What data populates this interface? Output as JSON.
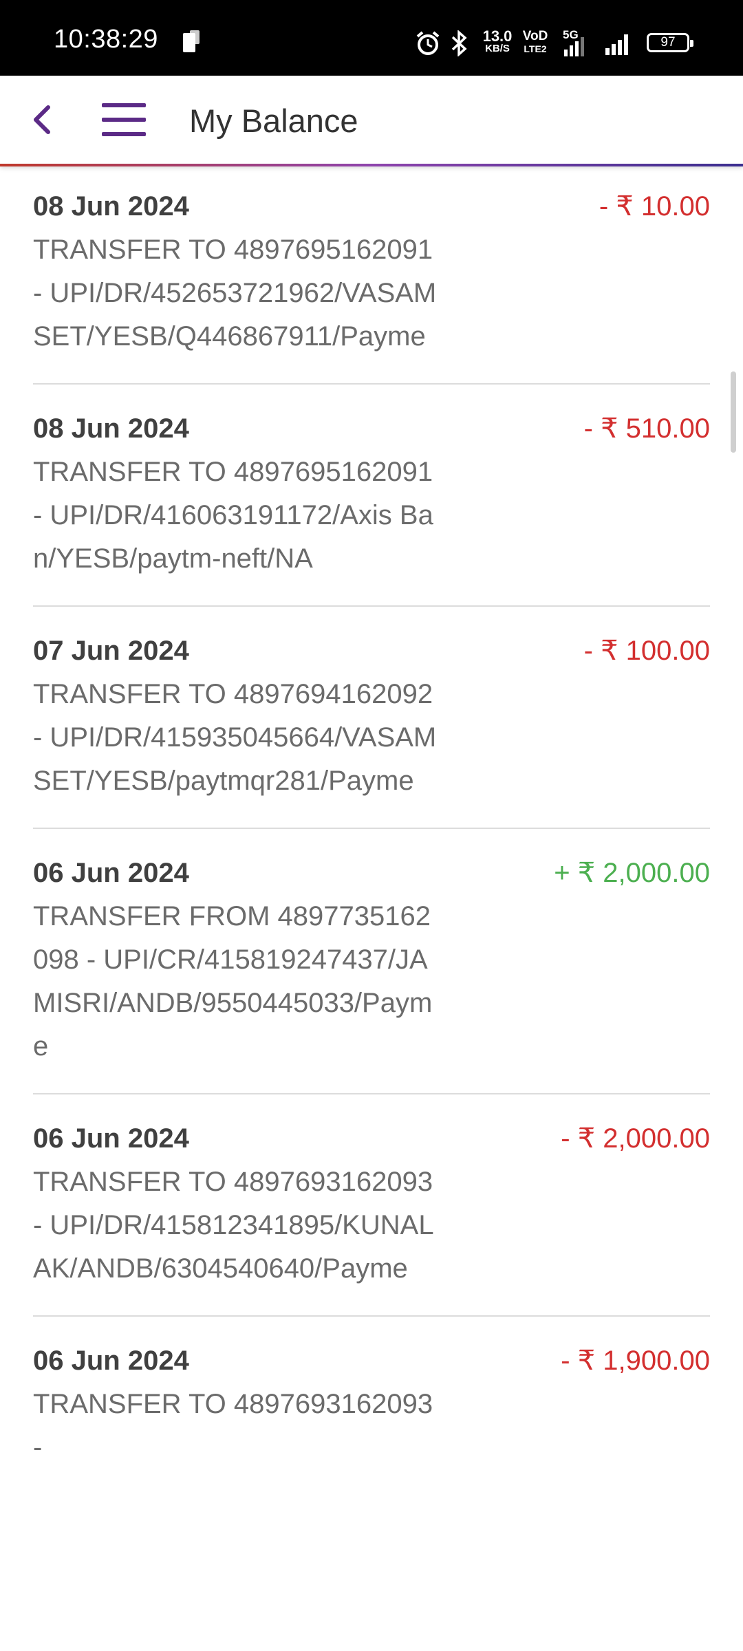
{
  "status_bar": {
    "time": "10:38:29",
    "net_speed_value": "13.0",
    "net_speed_unit": "KB/S",
    "volte_top": "VoD",
    "volte_bottom": "LTE2",
    "network": "5G",
    "battery": "97"
  },
  "app_bar": {
    "title": "My Balance"
  },
  "transactions": [
    {
      "date": "08 Jun 2024",
      "amount": "- ₹  10.00",
      "type": "debit",
      "description": "TRANSFER TO 4897695162091 - UPI/DR/452653721962/VASAMSET/YESB/Q446867911/Payme"
    },
    {
      "date": "08 Jun 2024",
      "amount": "- ₹  510.00",
      "type": "debit",
      "description": "TRANSFER TO 4897695162091 - UPI/DR/416063191172/Axis Ban/YESB/paytm-neft/NA"
    },
    {
      "date": "07 Jun 2024",
      "amount": "- ₹  100.00",
      "type": "debit",
      "description": "TRANSFER TO 4897694162092 - UPI/DR/415935045664/VASAMSET/YESB/paytmqr281/Payme"
    },
    {
      "date": "06 Jun 2024",
      "amount": "+ ₹  2,000.00",
      "type": "credit",
      "description": "TRANSFER FROM 4897735162098 - UPI/CR/415819247437/JAMISRI/ANDB/9550445033/Payme"
    },
    {
      "date": "06 Jun 2024",
      "amount": "- ₹  2,000.00",
      "type": "debit",
      "description": "TRANSFER TO 4897693162093 - UPI/DR/415812341895/KUNALAK/ANDB/6304540640/Payme"
    },
    {
      "date": "06 Jun 2024",
      "amount": "- ₹  1,900.00",
      "type": "debit",
      "description": "TRANSFER TO 4897693162093 -"
    }
  ]
}
